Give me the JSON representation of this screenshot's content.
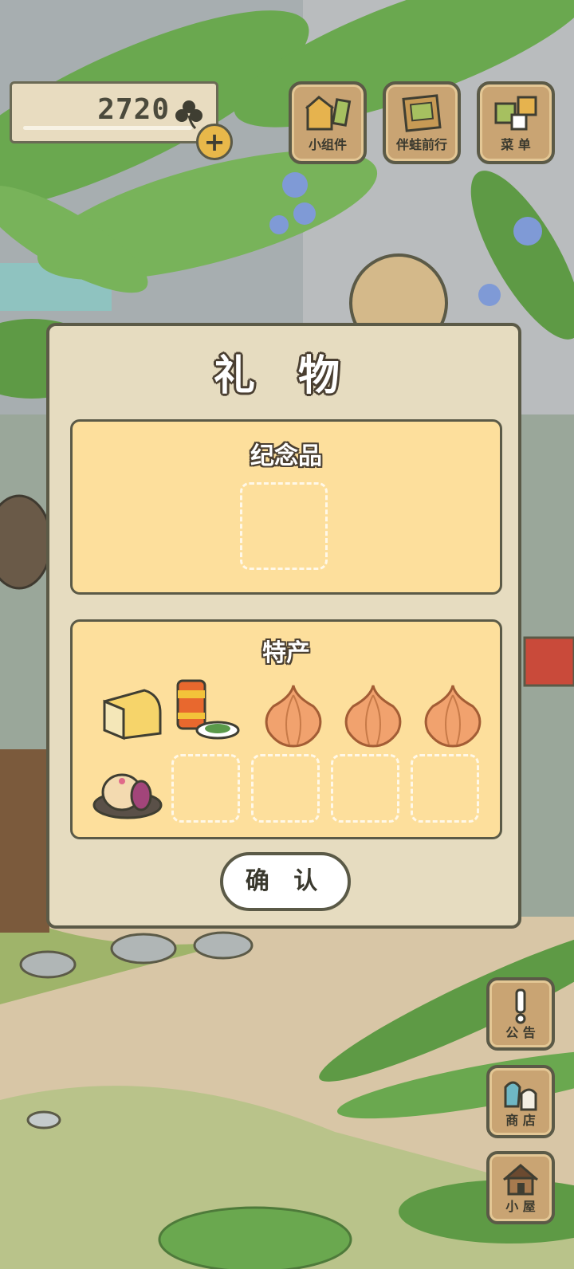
{
  "hud": {
    "clover_count": "2720",
    "plus_label": "+"
  },
  "top_menu": [
    {
      "label": "小组件",
      "icon": "widget-icon"
    },
    {
      "label": "伴蛙前行",
      "icon": "journal-icon"
    },
    {
      "label": "菜 单",
      "icon": "menu-icon"
    }
  ],
  "side_menu": [
    {
      "label": "公 告",
      "icon": "exclamation-icon"
    },
    {
      "label": "商 店",
      "icon": "shop-bag-icon"
    },
    {
      "label": "小 屋",
      "icon": "house-icon"
    }
  ],
  "gift_dialog": {
    "title": "礼 物",
    "souvenir_section": {
      "title": "纪念品",
      "slots": [
        "empty"
      ]
    },
    "specialty_section": {
      "title": "特产",
      "items": [
        "cheese-icon",
        "tea-can-icon",
        "onion-icon",
        "onion-icon",
        "onion-icon",
        "mooncake-icon",
        "empty",
        "empty",
        "empty",
        "empty"
      ]
    },
    "confirm_label": "确 认"
  },
  "colors": {
    "panel_fill": "#fddf9c",
    "dialog_fill": "#e6dcc0",
    "button_wood": "#c9a473",
    "outline": "#5b5a47"
  }
}
